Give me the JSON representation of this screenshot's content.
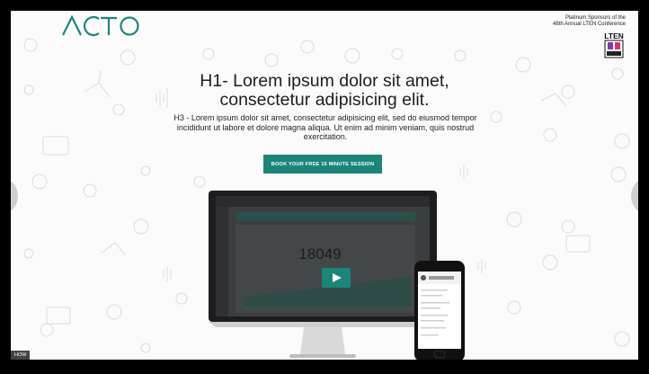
{
  "brand": {
    "logo_text": "ACTO",
    "accent": "#1c8579"
  },
  "sponsor": {
    "line1": "Platinum Sponsors of the",
    "line2": "48th Annual LTEN Conference",
    "badge_text": "LTEN"
  },
  "hero": {
    "title_line1": "H1- Lorem ipsum dolor sit amet,",
    "title_line2": "consectetur adipisicing elit.",
    "subtitle": "H3 - Lorem ipsum dolor sit amet, consectetur adipisicing elit, sed do eiusmod tempor incididunt ut labore et dolore magna aliqua. Ut enim ad minim veniam, quis nostrud exercitation.",
    "cta_label": "BOOK YOUR FREE 15 MINUTE SESSION"
  },
  "video": {
    "big_number": "18049"
  },
  "badge": {
    "label": "HOW"
  }
}
